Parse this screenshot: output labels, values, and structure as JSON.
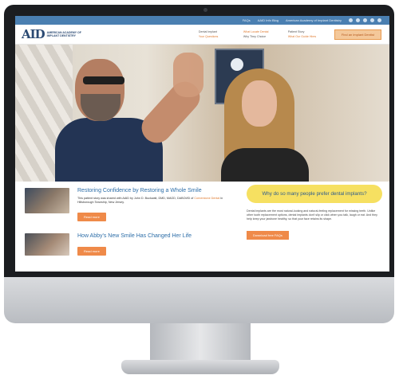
{
  "topbar": {
    "links": [
      "FAQs",
      "AAID Info Blog",
      "American Academy of Implant Dentistry"
    ]
  },
  "header": {
    "logo_mark": "AID",
    "logo_text": "AMERICAN ACADEMY OF IMPLANT DENTISTRY",
    "nav": [
      "Dental Implant",
      "What Locate Dental",
      "Patient Story",
      "Your Questions",
      "Why They Choice",
      "What Our Guide Hires"
    ],
    "cta": "Find an Implant Dentist"
  },
  "posts": [
    {
      "title": "Restoring Confidence by Restoring a Whole Smile",
      "text_start": "This patient story was shared with AAID by John D. Buckwalt, DMD, MAGD, DABOI/ID of ",
      "text_link": "Cornerstone Dental",
      "text_end": " in Hillsborough Township, New Jersey.",
      "button": "Read more"
    },
    {
      "title": "How Abby's New Smile Has Changed Her Life",
      "button": "Read more"
    }
  ],
  "sidebar": {
    "bubble": "Why do so many people prefer dental implants?",
    "text": "Dental implants are the most natural-looking and natural-feeling replacement for missing teeth. Unlike other tooth replacement options, dental implants don't slip or click when you talk, laugh or eat. And they help keep your jawbone healthy, so that your face retains its shape.",
    "button": "Download free FAQs"
  },
  "colors": {
    "accent": "#ef8a49",
    "brand": "#2d6ea8",
    "topbar": "#4a7fb1",
    "bubble": "#f6e061"
  }
}
